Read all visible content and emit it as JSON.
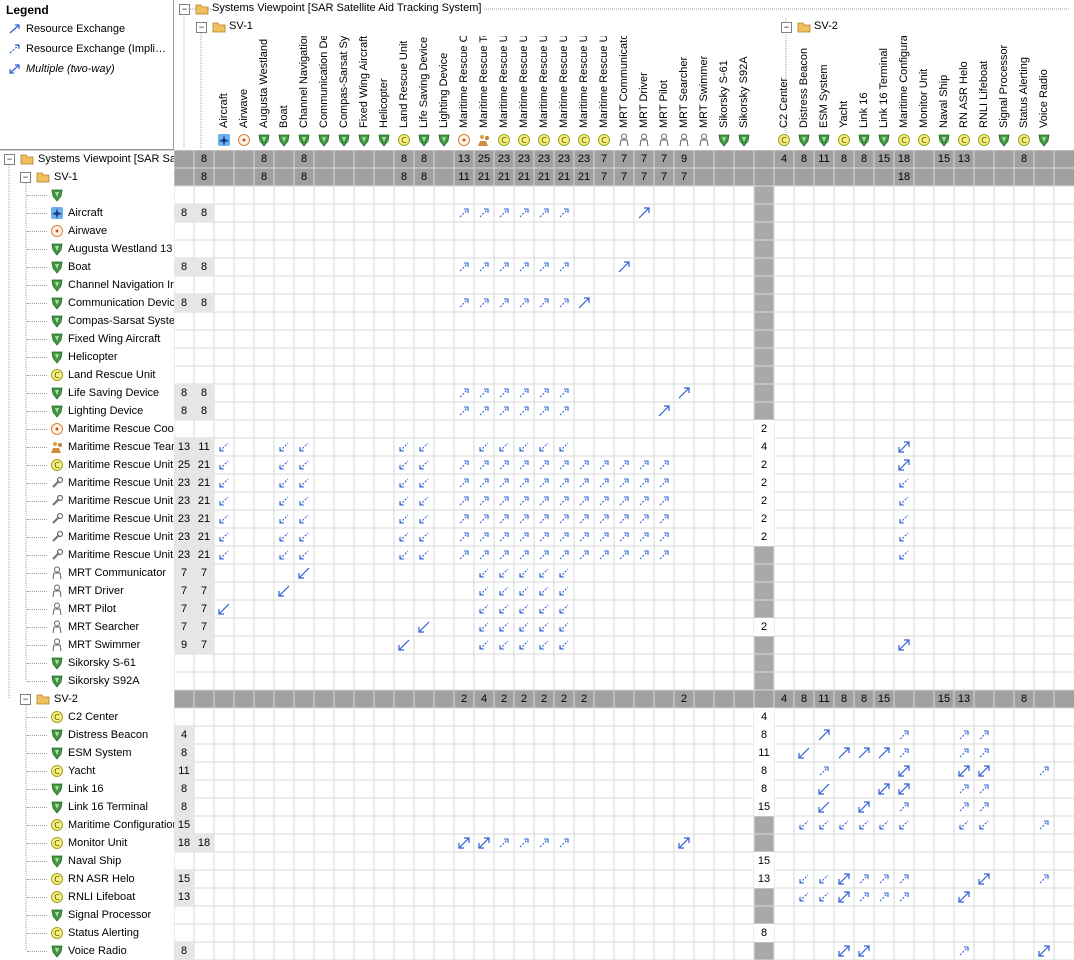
{
  "legend": {
    "title": "Legend",
    "items": [
      {
        "label": "Resource Exchange",
        "kind": "explicit"
      },
      {
        "label": "Resource Exchange (Impli…",
        "kind": "implied"
      },
      {
        "label": "Multiple (two-way)",
        "kind": "multiple"
      }
    ]
  },
  "colors": {
    "grid_line": "#d9d9d9",
    "gray_band": "#a0a0a0",
    "arrow": "#2f5fd6",
    "folder": "#f0c060",
    "shield": "#3f9a3f"
  },
  "header": {
    "top_title": "Systems Viewpoint [SAR Satellite Aid Tracking System]",
    "groups": [
      {
        "label": "SV-1"
      },
      {
        "label": "SV-2"
      }
    ],
    "columns": [
      {
        "label": "Aircraft",
        "icon": "airplane-icon"
      },
      {
        "label": "Airwave",
        "icon": "signal-icon"
      },
      {
        "label": "Augusta Westland",
        "icon": "shield-icon"
      },
      {
        "label": "Boat",
        "icon": "shield-icon"
      },
      {
        "label": "Channel Navigation",
        "icon": "shield-icon"
      },
      {
        "label": "Communication Dev",
        "icon": "shield-icon"
      },
      {
        "label": "Compas-Sarsat Sys",
        "icon": "shield-icon"
      },
      {
        "label": "Fixed Wing Aircraft",
        "icon": "shield-icon"
      },
      {
        "label": "Helicopter",
        "icon": "shield-icon"
      },
      {
        "label": "Land Rescue Unit",
        "icon": "capability-icon"
      },
      {
        "label": "Life Saving Device",
        "icon": "shield-icon"
      },
      {
        "label": "Lighting Device",
        "icon": "shield-icon"
      },
      {
        "label": "Maritime Rescue Co",
        "icon": "signal-icon"
      },
      {
        "label": "Maritime Rescue Te",
        "icon": "team-icon"
      },
      {
        "label": "Maritime Rescue Ur",
        "icon": "capability-icon"
      },
      {
        "label": "Maritime Rescue Ur",
        "icon": "capability-icon"
      },
      {
        "label": "Maritime Rescue Ur",
        "icon": "capability-icon"
      },
      {
        "label": "Maritime Rescue Ur",
        "icon": "capability-icon"
      },
      {
        "label": "Maritime Rescue Ur",
        "icon": "capability-icon"
      },
      {
        "label": "Maritime Rescue Ur",
        "icon": "capability-icon"
      },
      {
        "label": "MRT Communicator",
        "icon": "person-icon"
      },
      {
        "label": "MRT Driver",
        "icon": "person-icon"
      },
      {
        "label": "MRT Pilot",
        "icon": "person-icon"
      },
      {
        "label": "MRT Searcher",
        "icon": "person-icon"
      },
      {
        "label": "MRT Swimmer",
        "icon": "person-icon"
      },
      {
        "label": "Sikorsky S-61",
        "icon": "shield-icon"
      },
      {
        "label": "Sikorsky S92A",
        "icon": "shield-icon"
      },
      {
        "label": "",
        "icon": ""
      },
      {
        "label": "C2 Center",
        "icon": "capability-icon"
      },
      {
        "label": "Distress Beacon",
        "icon": "shield-icon"
      },
      {
        "label": "ESM System",
        "icon": "shield-icon"
      },
      {
        "label": "Yacht",
        "icon": "capability-icon"
      },
      {
        "label": "Link 16",
        "icon": "shield-icon"
      },
      {
        "label": "Link 16 Terminal",
        "icon": "shield-icon"
      },
      {
        "label": "Maritime Configural",
        "icon": "capability-icon"
      },
      {
        "label": "Monitor Unit",
        "icon": "capability-icon"
      },
      {
        "label": "Naval Ship",
        "icon": "shield-icon"
      },
      {
        "label": "RN ASR Helo",
        "icon": "capability-icon"
      },
      {
        "label": "RNLI Lifeboat",
        "icon": "capability-icon"
      },
      {
        "label": "Signal Processor",
        "icon": "shield-icon"
      },
      {
        "label": "Status Alerting",
        "icon": "capability-icon"
      },
      {
        "label": "Voice Radio",
        "icon": "shield-icon"
      }
    ]
  },
  "rows": [
    {
      "label": "Systems Viewpoint [SAR Sate",
      "icon": "folder-icon",
      "level": 0,
      "gray": true,
      "c0": "",
      "c1": "",
      "vals": [
        "8",
        "",
        "",
        "8",
        "",
        "8",
        "",
        "",
        "",
        "",
        "8",
        "8",
        "",
        "13",
        "25",
        "23",
        "23",
        "23",
        "23",
        "23",
        "7",
        "7",
        "7",
        "7",
        "9",
        "",
        "",
        "",
        "",
        "4",
        "8",
        "11",
        "8",
        "8",
        "15",
        "18",
        "",
        "15",
        "13",
        "",
        "",
        "8"
      ]
    },
    {
      "label": "SV-1",
      "icon": "folder-icon",
      "level": 1,
      "gray": true,
      "c0": "",
      "c1": "",
      "vals": [
        "8",
        "",
        "",
        "8",
        "",
        "8",
        "",
        "",
        "",
        "",
        "8",
        "8",
        "",
        "11",
        "21",
        "21",
        "21",
        "21",
        "21",
        "21",
        "7",
        "7",
        "7",
        "7",
        "7",
        "",
        "",
        "",
        "",
        "",
        "",
        "",
        "",
        "",
        "",
        "18",
        "",
        "",
        "",
        "",
        ""
      ]
    },
    {
      "label": "",
      "icon": "shield-icon",
      "level": 2,
      "c0": "",
      "c1": ""
    },
    {
      "label": "Aircraft",
      "icon": "airplane-icon",
      "level": 2,
      "c0": "8",
      "c1": "8"
    },
    {
      "label": "Airwave",
      "icon": "signal-icon",
      "level": 2,
      "c0": "",
      "c1": ""
    },
    {
      "label": "Augusta Westland 13",
      "icon": "shield-icon",
      "level": 2,
      "c0": "",
      "c1": ""
    },
    {
      "label": "Boat",
      "icon": "shield-icon",
      "level": 2,
      "c0": "8",
      "c1": "8"
    },
    {
      "label": "Channel Navigation In",
      "icon": "shield-icon",
      "level": 2,
      "c0": "",
      "c1": ""
    },
    {
      "label": "Communication Device",
      "icon": "shield-icon",
      "level": 2,
      "c0": "8",
      "c1": "8"
    },
    {
      "label": "Compas-Sarsat Syster",
      "icon": "shield-icon",
      "level": 2,
      "c0": "",
      "c1": ""
    },
    {
      "label": "Fixed Wing Aircraft",
      "icon": "shield-icon",
      "level": 2,
      "c0": "",
      "c1": ""
    },
    {
      "label": "Helicopter",
      "icon": "shield-icon",
      "level": 2,
      "c0": "",
      "c1": ""
    },
    {
      "label": "Land Rescue Unit",
      "icon": "capability-icon",
      "level": 2,
      "c0": "",
      "c1": ""
    },
    {
      "label": "Life Saving Device",
      "icon": "shield-icon",
      "level": 2,
      "c0": "8",
      "c1": "8"
    },
    {
      "label": "Lighting Device",
      "icon": "shield-icon",
      "level": 2,
      "c0": "8",
      "c1": "8"
    },
    {
      "label": "Maritime Rescue Coor",
      "icon": "signal-icon",
      "level": 2,
      "c0": "",
      "c1": ""
    },
    {
      "label": "Maritime Rescue Team",
      "icon": "team-icon",
      "level": 2,
      "c0": "13",
      "c1": "11"
    },
    {
      "label": "Maritime Rescue Unit",
      "icon": "capability-icon",
      "level": 2,
      "c0": "25",
      "c1": "21"
    },
    {
      "label": "Maritime Rescue Unit I",
      "icon": "wrench-icon",
      "level": 2,
      "c0": "23",
      "c1": "21"
    },
    {
      "label": "Maritime Rescue Unit I",
      "icon": "wrench-icon",
      "level": 2,
      "c0": "23",
      "c1": "21"
    },
    {
      "label": "Maritime Rescue Unit I",
      "icon": "wrench-icon",
      "level": 2,
      "c0": "23",
      "c1": "21"
    },
    {
      "label": "Maritime Rescue Unit I",
      "icon": "wrench-icon",
      "level": 2,
      "c0": "23",
      "c1": "21"
    },
    {
      "label": "Maritime Rescue Unit '",
      "icon": "wrench-icon",
      "level": 2,
      "c0": "23",
      "c1": "21"
    },
    {
      "label": "MRT Communicator",
      "icon": "person-icon",
      "level": 2,
      "c0": "7",
      "c1": "7"
    },
    {
      "label": "MRT Driver",
      "icon": "person-icon",
      "level": 2,
      "c0": "7",
      "c1": "7"
    },
    {
      "label": "MRT Pilot",
      "icon": "person-icon",
      "level": 2,
      "c0": "7",
      "c1": "7"
    },
    {
      "label": "MRT Searcher",
      "icon": "person-icon",
      "level": 2,
      "c0": "7",
      "c1": "7"
    },
    {
      "label": "MRT Swimmer",
      "icon": "person-icon",
      "level": 2,
      "c0": "9",
      "c1": "7"
    },
    {
      "label": "Sikorsky S-61",
      "icon": "shield-icon",
      "level": 2,
      "c0": "",
      "c1": ""
    },
    {
      "label": "Sikorsky S92A",
      "icon": "shield-icon",
      "level": 2,
      "c0": "",
      "c1": ""
    },
    {
      "label": "SV-2",
      "icon": "folder-icon",
      "level": 1,
      "gray": true,
      "c0": "",
      "c1": "",
      "vals": [
        "",
        "",
        "",
        "",
        "",
        "",
        "",
        "",
        "",
        "",
        "",
        "",
        "",
        "2",
        "4",
        "2",
        "2",
        "2",
        "2",
        "2",
        "",
        "",
        "",
        "",
        "2",
        "",
        "",
        "",
        "",
        "4",
        "8",
        "11",
        "8",
        "8",
        "15",
        "",
        "",
        "15",
        "13",
        "",
        "",
        "8"
      ]
    },
    {
      "label": "C2 Center",
      "icon": "capability-icon",
      "level": 2,
      "c0": "",
      "c1": ""
    },
    {
      "label": "Distress Beacon",
      "icon": "shield-icon",
      "level": 2,
      "c0": "4",
      "c1": ""
    },
    {
      "label": "ESM System",
      "icon": "shield-icon",
      "level": 2,
      "c0": "8",
      "c1": ""
    },
    {
      "label": "Yacht",
      "icon": "capability-icon",
      "level": 2,
      "c0": "11",
      "c1": ""
    },
    {
      "label": "Link 16",
      "icon": "shield-icon",
      "level": 2,
      "c0": "8",
      "c1": ""
    },
    {
      "label": "Link 16 Terminal",
      "icon": "shield-icon",
      "level": 2,
      "c0": "8",
      "c1": ""
    },
    {
      "label": "Maritime Configuration",
      "icon": "capability-icon",
      "level": 2,
      "c0": "15",
      "c1": ""
    },
    {
      "label": "Monitor Unit",
      "icon": "capability-icon",
      "level": 2,
      "c0": "18",
      "c1": "18"
    },
    {
      "label": "Naval Ship",
      "icon": "shield-icon",
      "level": 2,
      "c0": "",
      "c1": ""
    },
    {
      "label": "RN ASR Helo",
      "icon": "capability-icon",
      "level": 2,
      "c0": "15",
      "c1": ""
    },
    {
      "label": "RNLI Lifeboat",
      "icon": "capability-icon",
      "level": 2,
      "c0": "13",
      "c1": ""
    },
    {
      "label": "Signal Processor",
      "icon": "shield-icon",
      "level": 2,
      "c0": "",
      "c1": ""
    },
    {
      "label": "Status Alerting",
      "icon": "capability-icon",
      "level": 2,
      "c0": "",
      "c1": ""
    },
    {
      "label": "Voice Radio",
      "icon": "shield-icon",
      "level": 2,
      "c0": "8",
      "c1": ""
    }
  ],
  "sv2_row_counts": [
    "",
    "",
    "",
    "",
    "",
    "",
    "",
    "",
    "",
    "",
    "",
    "",
    "",
    "",
    "",
    "2",
    "4",
    "2",
    "2",
    "2",
    "2",
    "2",
    "",
    "",
    "",
    "",
    "2",
    "",
    "",
    "",
    "",
    "4",
    "8",
    "11",
    "8",
    "8",
    "15",
    "",
    "",
    "15",
    "13",
    "",
    "",
    "8"
  ],
  "cells": [
    {
      "r": 3,
      "c": "13,14,15,16,17,18",
      "k": "i"
    },
    {
      "r": 3,
      "c": "22",
      "k": "e"
    },
    {
      "r": 6,
      "c": "13,14,15,16,17,18",
      "k": "i"
    },
    {
      "r": 6,
      "c": "21",
      "k": "e"
    },
    {
      "r": 8,
      "c": "13,14,15,16,17,18",
      "k": "i"
    },
    {
      "r": 8,
      "c": "19",
      "k": "e"
    },
    {
      "r": 13,
      "c": "13,14,15,16,17,18",
      "k": "i"
    },
    {
      "r": 13,
      "c": "24",
      "k": "e"
    },
    {
      "r": 14,
      "c": "13,14,15,16,17,18",
      "k": "i"
    },
    {
      "r": 14,
      "c": "23",
      "k": "e"
    },
    {
      "r": 16,
      "c": "1,4,5,10,11,14,15,16,17,18",
      "k": "d"
    },
    {
      "r": 16,
      "c": "35",
      "k": "m"
    },
    {
      "r": 17,
      "c": "1,4,5,10,11",
      "k": "d"
    },
    {
      "r": 17,
      "c": "13,14,15,16,17,18,19,20,21,22,23",
      "k": "i"
    },
    {
      "r": 17,
      "c": "35",
      "k": "m"
    },
    {
      "r": 18,
      "c": "1,4,5,10,11",
      "k": "d"
    },
    {
      "r": 18,
      "c": "13,14,15,16,17,18,19,20,21,22,23",
      "k": "i"
    },
    {
      "r": 18,
      "c": "35",
      "k": "d"
    },
    {
      "r": 19,
      "c": "1,4,5,10,11",
      "k": "d"
    },
    {
      "r": 19,
      "c": "13,14,15,16,17,18,19,20,21,22,23",
      "k": "i"
    },
    {
      "r": 19,
      "c": "35",
      "k": "d"
    },
    {
      "r": 20,
      "c": "1,4,5,10,11",
      "k": "d"
    },
    {
      "r": 20,
      "c": "13,14,15,16,17,18,19,20,21,22,23",
      "k": "i"
    },
    {
      "r": 20,
      "c": "35",
      "k": "d"
    },
    {
      "r": 21,
      "c": "1,4,5,10,11",
      "k": "d"
    },
    {
      "r": 21,
      "c": "13,14,15,16,17,18,19,20,21,22,23",
      "k": "i"
    },
    {
      "r": 21,
      "c": "35",
      "k": "d"
    },
    {
      "r": 22,
      "c": "1,4,5,10,11",
      "k": "d"
    },
    {
      "r": 22,
      "c": "13,14,15,16,17,18,19,20,21,22,23",
      "k": "i"
    },
    {
      "r": 22,
      "c": "35",
      "k": "d"
    },
    {
      "r": 23,
      "c": "5",
      "k": "de"
    },
    {
      "r": 23,
      "c": "14,15,16,17,18",
      "k": "d"
    },
    {
      "r": 24,
      "c": "4",
      "k": "de"
    },
    {
      "r": 24,
      "c": "14,15,16,17,18",
      "k": "d"
    },
    {
      "r": 25,
      "c": "1",
      "k": "de"
    },
    {
      "r": 25,
      "c": "14,15,16,17,18",
      "k": "d"
    },
    {
      "r": 26,
      "c": "11",
      "k": "de"
    },
    {
      "r": 26,
      "c": "14,15,16,17,18",
      "k": "d"
    },
    {
      "r": 27,
      "c": "10",
      "k": "de"
    },
    {
      "r": 27,
      "c": "14,15,16,17,18",
      "k": "d"
    },
    {
      "r": 27,
      "c": "35",
      "k": "m"
    },
    {
      "r": 32,
      "c": "31",
      "k": "e"
    },
    {
      "r": 32,
      "c": "35",
      "k": "i"
    },
    {
      "r": 32,
      "c": "38,39",
      "k": "i"
    },
    {
      "r": 33,
      "c": "30",
      "k": "de"
    },
    {
      "r": 33,
      "c": "32,33,34",
      "k": "e"
    },
    {
      "r": 33,
      "c": "35",
      "k": "i"
    },
    {
      "r": 33,
      "c": "38,39",
      "k": "i"
    },
    {
      "r": 34,
      "c": "31",
      "k": "i"
    },
    {
      "r": 34,
      "c": "35",
      "k": "m"
    },
    {
      "r": 34,
      "c": "38,39",
      "k": "m"
    },
    {
      "r": 34,
      "c": "42",
      "k": "i"
    },
    {
      "r": 35,
      "c": "31",
      "k": "de"
    },
    {
      "r": 35,
      "c": "34",
      "k": "m"
    },
    {
      "r": 35,
      "c": "35",
      "k": "m"
    },
    {
      "r": 35,
      "c": "38,39",
      "k": "i"
    },
    {
      "r": 36,
      "c": "31",
      "k": "de"
    },
    {
      "r": 36,
      "c": "33",
      "k": "m"
    },
    {
      "r": 36,
      "c": "35",
      "k": "i"
    },
    {
      "r": 36,
      "c": "38,39",
      "k": "i"
    },
    {
      "r": 37,
      "c": "30,31,32,33,34,35",
      "k": "d"
    },
    {
      "r": 37,
      "c": "38,39",
      "k": "d"
    },
    {
      "r": 37,
      "c": "42",
      "k": "i"
    },
    {
      "r": 38,
      "c": "13,14",
      "k": "m"
    },
    {
      "r": 38,
      "c": "15,16,17,18",
      "k": "i"
    },
    {
      "r": 38,
      "c": "24",
      "k": "m"
    },
    {
      "r": 40,
      "c": "30,31",
      "k": "d"
    },
    {
      "r": 40,
      "c": "32",
      "k": "m"
    },
    {
      "r": 40,
      "c": "33,34,35",
      "k": "i"
    },
    {
      "r": 40,
      "c": "39",
      "k": "m"
    },
    {
      "r": 40,
      "c": "42",
      "k": "i"
    },
    {
      "r": 41,
      "c": "30,31",
      "k": "d"
    },
    {
      "r": 41,
      "c": "32",
      "k": "m"
    },
    {
      "r": 41,
      "c": "33,34,35",
      "k": "i"
    },
    {
      "r": 41,
      "c": "38",
      "k": "m"
    },
    {
      "r": 44,
      "c": "32,33",
      "k": "m"
    },
    {
      "r": 44,
      "c": "38",
      "k": "i"
    },
    {
      "r": 44,
      "c": "42",
      "k": "m"
    }
  ]
}
